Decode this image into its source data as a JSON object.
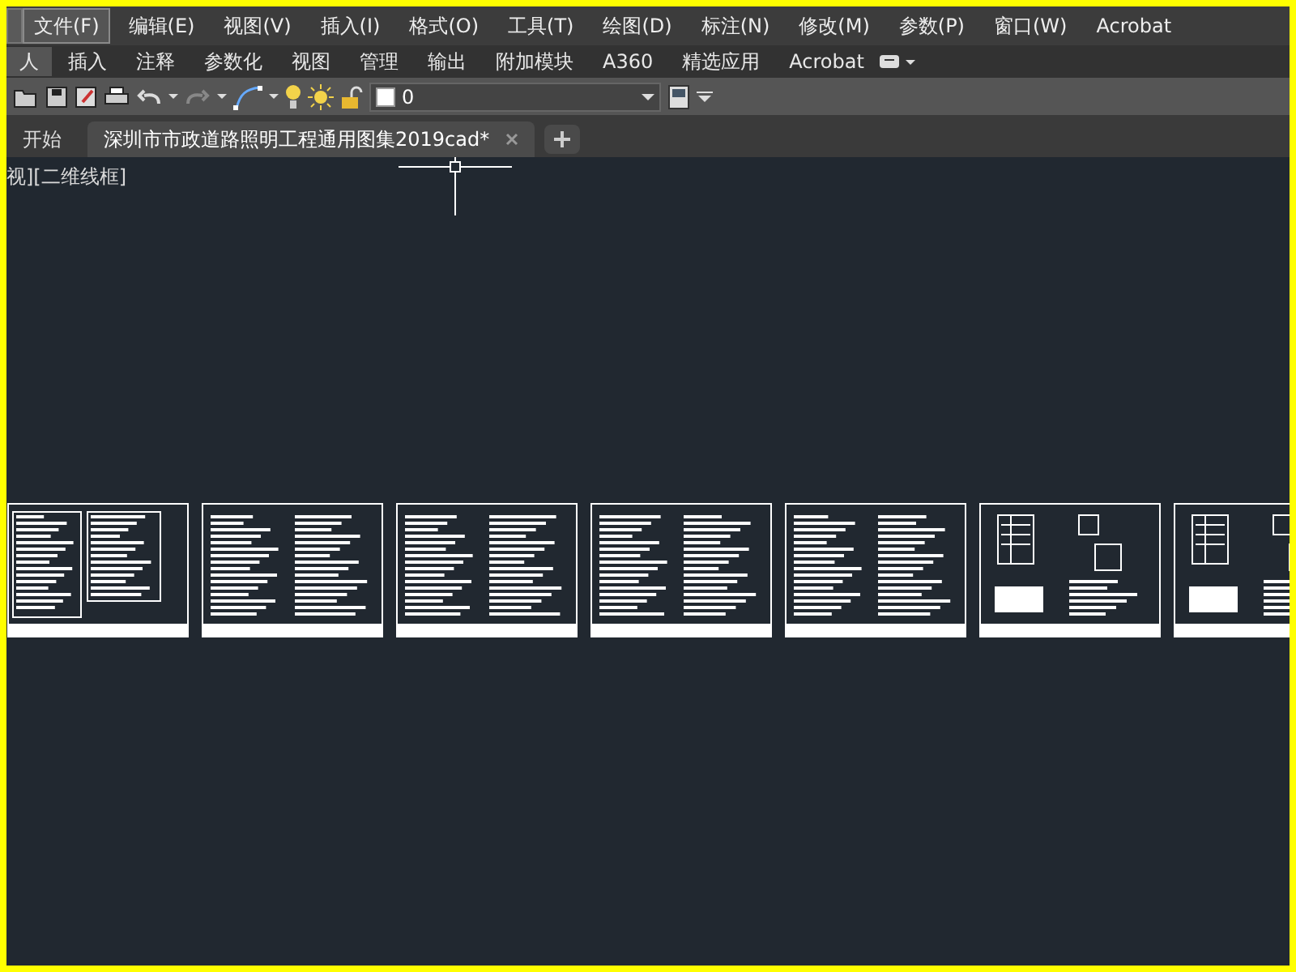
{
  "menu": [
    {
      "label": "文件(F)",
      "selected": true
    },
    {
      "label": "编辑(E)",
      "selected": false
    },
    {
      "label": "视图(V)",
      "selected": false
    },
    {
      "label": "插入(I)",
      "selected": false
    },
    {
      "label": "格式(O)",
      "selected": false
    },
    {
      "label": "工具(T)",
      "selected": false
    },
    {
      "label": "绘图(D)",
      "selected": false
    },
    {
      "label": "标注(N)",
      "selected": false
    },
    {
      "label": "修改(M)",
      "selected": false
    },
    {
      "label": "参数(P)",
      "selected": false
    },
    {
      "label": "窗口(W)",
      "selected": false
    },
    {
      "label": "Acrobat",
      "selected": false
    }
  ],
  "ribbon_tabs": [
    {
      "label": "人",
      "selected": true
    },
    {
      "label": "插入",
      "selected": false
    },
    {
      "label": "注释",
      "selected": false
    },
    {
      "label": "参数化",
      "selected": false
    },
    {
      "label": "视图",
      "selected": false
    },
    {
      "label": "管理",
      "selected": false
    },
    {
      "label": "输出",
      "selected": false
    },
    {
      "label": "附加模块",
      "selected": false
    },
    {
      "label": "A360",
      "selected": false
    },
    {
      "label": "精选应用",
      "selected": false
    },
    {
      "label": "Acrobat",
      "selected": false
    }
  ],
  "toolbar": {
    "layer_name": "0"
  },
  "file_tabs": [
    {
      "label": "开始",
      "selected": false,
      "closable": false
    },
    {
      "label": "深圳市市政道路照明工程通用图集2019cad*",
      "selected": true,
      "closable": true
    }
  ],
  "viewport_label": "视][二维线框]",
  "sheets": [
    {
      "kind": "table"
    },
    {
      "kind": "text"
    },
    {
      "kind": "text"
    },
    {
      "kind": "text"
    },
    {
      "kind": "text"
    },
    {
      "kind": "detail"
    },
    {
      "kind": "detail"
    }
  ]
}
